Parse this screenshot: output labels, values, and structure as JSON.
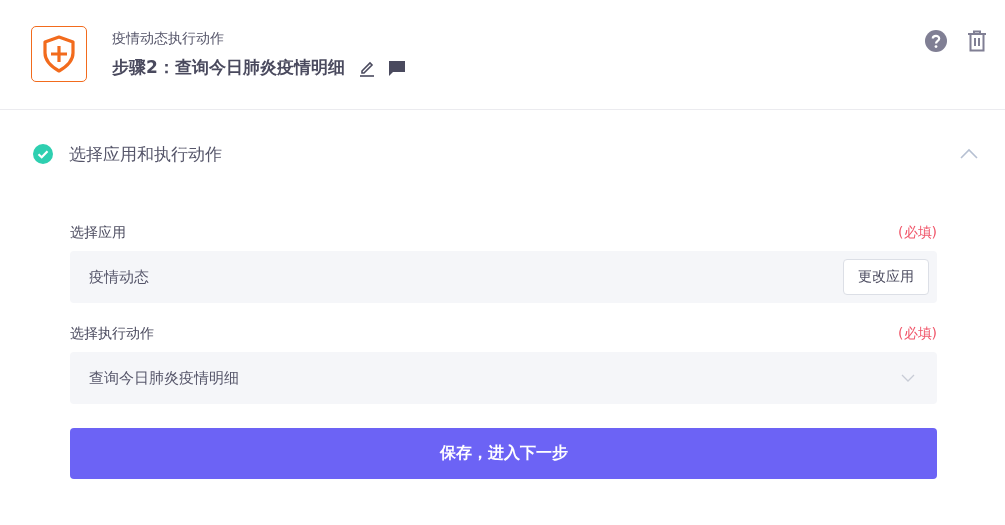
{
  "header": {
    "subtitle": "疫情动态执行动作",
    "title": "步骤2：查询今日肺炎疫情明细"
  },
  "section": {
    "title": "选择应用和执行动作",
    "completed": true,
    "expanded": true
  },
  "fields": [
    {
      "kind": "app",
      "label": "选择应用",
      "required_note": "(必填)",
      "value": "疫情动态",
      "button": "更改应用"
    },
    {
      "kind": "select",
      "label": "选择执行动作",
      "required_note": "(必填)",
      "value": "查询今日肺炎疫情明细"
    }
  ],
  "submit": "保存，进入下一步"
}
